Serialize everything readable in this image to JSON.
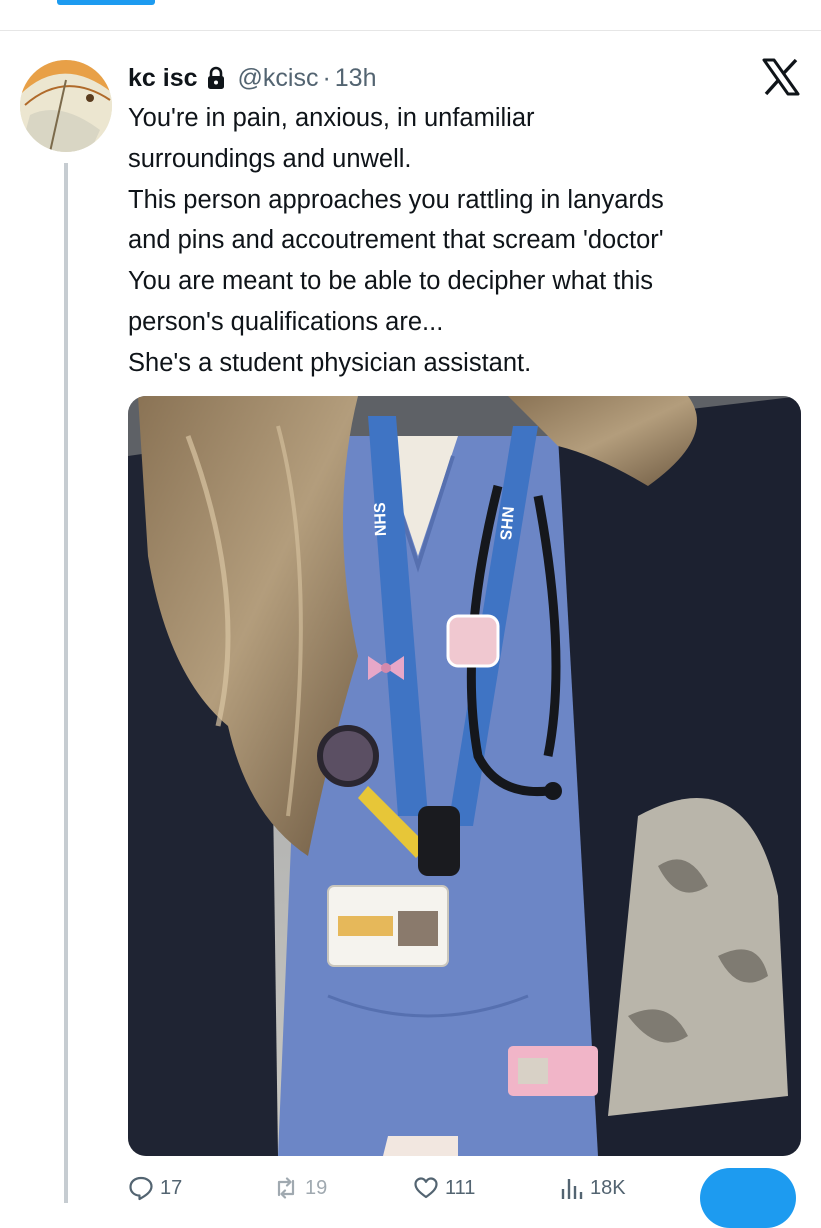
{
  "tweet": {
    "display_name": "kc isc",
    "handle": "@kcisc",
    "separator": "·",
    "time": "13h",
    "lines": [
      "You're in pain, anxious, in unfamiliar",
      "surroundings and unwell.",
      "This person approaches you rattling in lanyards",
      "and pins and accoutrement that scream 'doctor'",
      "You are meant to be able to decipher what this",
      "person's qualifications are...",
      "She's a student physician assistant."
    ]
  },
  "icons": {
    "lock": "lock-icon",
    "platform_logo": "x-logo-icon",
    "reply": "reply-icon",
    "retweet": "retweet-icon",
    "like": "heart-icon",
    "views": "views-bar-chart-icon"
  },
  "actions": {
    "replies": "17",
    "reposts": "19",
    "likes": "111",
    "views": "18K"
  },
  "photo": {
    "lanyard_text_1": "NHS",
    "lanyard_text_2": "NHS"
  },
  "colors": {
    "accent": "#1d9bf0",
    "text_primary": "#0f1419",
    "text_secondary": "#536471",
    "scrubs": "#6c86c6",
    "lanyard": "#3f74c4"
  }
}
